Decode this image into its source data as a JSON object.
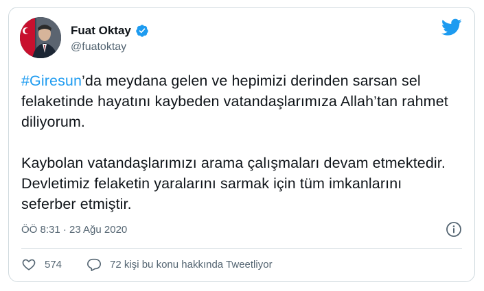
{
  "tweet": {
    "author_name": "Fuat Oktay",
    "author_handle": "@fuatoktay",
    "hashtag": "#Giresun",
    "paragraph1_rest": "’da meydana gelen ve hepimizi derinden sarsan sel felaketinde hayatını kaybeden vatandaşlarımıza Allah’tan rahmet diliyorum.",
    "paragraph2": "Kaybolan vatandaşlarımızı arama çalışmaları devam etmektedir. Devletimiz felaketin yaralarını sarmak için tüm imkanlarını seferber etmiştir.",
    "timestamp": "ÖÖ 8:31 · 23 Ağu 2020",
    "like_count": "574",
    "reply_text": "72 kişi bu konu hakkında Tweetliyor"
  },
  "colors": {
    "accent": "#1d9bf0",
    "text": "#0f1419",
    "secondary": "#536471",
    "border": "#cfd9de"
  },
  "icons": {
    "logo": "twitter-bird-icon",
    "verified": "verified-badge-icon",
    "info": "info-icon",
    "like": "heart-icon",
    "reply": "speech-bubble-icon"
  }
}
